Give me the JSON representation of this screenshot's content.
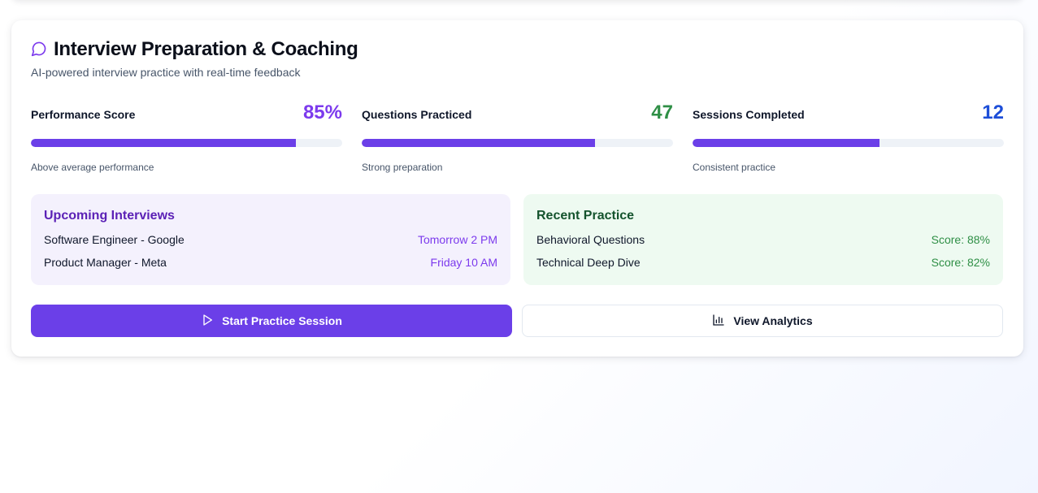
{
  "header": {
    "title": "Interview Preparation & Coaching",
    "subtitle": "AI-powered interview practice with real-time feedback",
    "icon": "chat-bubble-icon"
  },
  "metrics": [
    {
      "label": "Performance Score",
      "value": "85%",
      "note": "Above average performance",
      "progress": 0.85,
      "color": "#7c3aed"
    },
    {
      "label": "Questions Practiced",
      "value": "47",
      "note": "Strong preparation",
      "progress": 0.75,
      "color": "#2f8f46"
    },
    {
      "label": "Sessions Completed",
      "value": "12",
      "note": "Consistent practice",
      "progress": 0.6,
      "color": "#1d4ed8"
    }
  ],
  "upcoming": {
    "title": "Upcoming Interviews",
    "items": [
      {
        "name": "Software Engineer - Google",
        "time": "Tomorrow 2 PM"
      },
      {
        "name": "Product Manager - Meta",
        "time": "Friday 10 AM"
      }
    ]
  },
  "recent": {
    "title": "Recent Practice",
    "items": [
      {
        "name": "Behavioral Questions",
        "score": "Score: 88%"
      },
      {
        "name": "Technical Deep Dive",
        "score": "Score: 82%"
      }
    ]
  },
  "actions": {
    "start_label": "Start Practice Session",
    "start_icon": "play-icon",
    "analytics_label": "View Analytics",
    "analytics_icon": "bar-chart-icon"
  },
  "colors": {
    "accent": "#6b3fe8",
    "progress_track": "#eef2f7"
  }
}
